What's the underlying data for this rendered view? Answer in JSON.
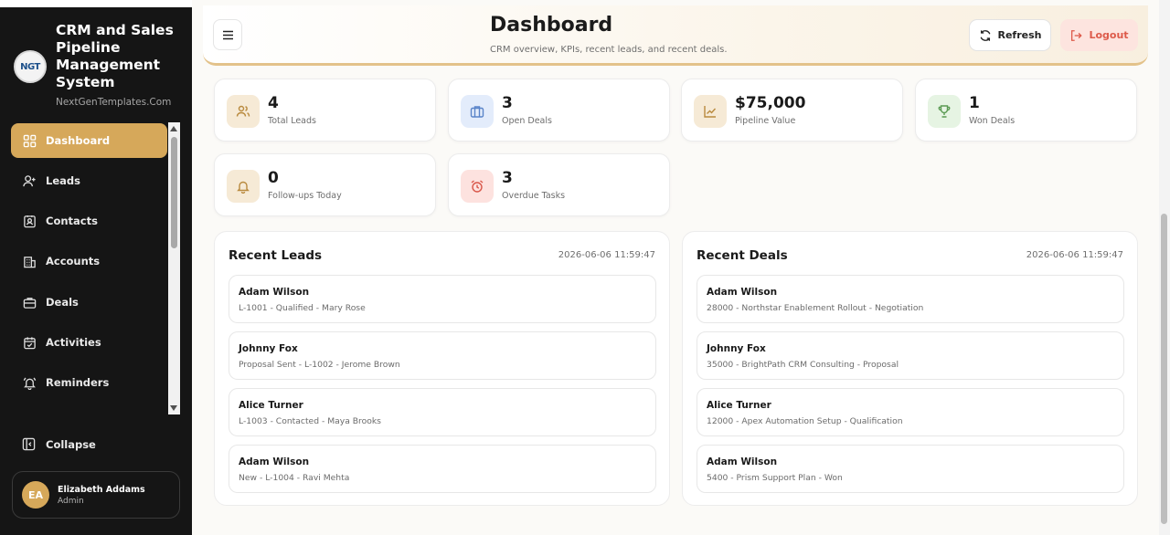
{
  "sidebar": {
    "brand_logo_text": "NGT",
    "brand_title": "CRM and Sales Pipeline Management System",
    "brand_subtitle": "NextGenTemplates.Com",
    "items": [
      {
        "label": "Dashboard",
        "icon": "grid-icon",
        "active": true
      },
      {
        "label": "Leads",
        "icon": "user-plus-icon",
        "active": false
      },
      {
        "label": "Contacts",
        "icon": "contact-card-icon",
        "active": false
      },
      {
        "label": "Accounts",
        "icon": "building-icon",
        "active": false
      },
      {
        "label": "Deals",
        "icon": "briefcase-icon",
        "active": false
      },
      {
        "label": "Activities",
        "icon": "calendar-check-icon",
        "active": false
      },
      {
        "label": "Reminders",
        "icon": "bell-ring-icon",
        "active": false
      }
    ],
    "collapse_label": "Collapse",
    "user": {
      "initials": "EA",
      "name": "Elizabeth Addams",
      "role": "Admin"
    }
  },
  "header": {
    "title": "Dashboard",
    "subtitle": "CRM overview, KPIs, recent leads, and recent deals.",
    "refresh_label": "Refresh",
    "logout_label": "Logout"
  },
  "kpis": [
    {
      "value": "4",
      "label": "Total Leads",
      "icon": "users-icon"
    },
    {
      "value": "3",
      "label": "Open Deals",
      "icon": "briefcase-icon"
    },
    {
      "value": "$75,000",
      "label": "Pipeline Value",
      "icon": "chart-line-icon"
    },
    {
      "value": "1",
      "label": "Won Deals",
      "icon": "trophy-icon"
    },
    {
      "value": "0",
      "label": "Follow-ups Today",
      "icon": "bell-icon"
    },
    {
      "value": "3",
      "label": "Overdue Tasks",
      "icon": "alarm-clock-icon"
    }
  ],
  "recent_leads": {
    "title": "Recent Leads",
    "timestamp": "2026-06-06 11:59:47",
    "items": [
      {
        "name": "Adam Wilson",
        "meta": "L-1001 - Qualified - Mary Rose"
      },
      {
        "name": "Johnny Fox",
        "meta": "Proposal Sent - L-1002 - Jerome Brown"
      },
      {
        "name": "Alice Turner",
        "meta": "L-1003 - Contacted - Maya Brooks"
      },
      {
        "name": "Adam Wilson",
        "meta": "New - L-1004 - Ravi Mehta"
      }
    ]
  },
  "recent_deals": {
    "title": "Recent Deals",
    "timestamp": "2026-06-06 11:59:47",
    "items": [
      {
        "name": "Adam Wilson",
        "meta": "28000 - Northstar Enablement Rollout - Negotiation"
      },
      {
        "name": "Johnny Fox",
        "meta": "35000 - BrightPath CRM Consulting - Proposal"
      },
      {
        "name": "Alice Turner",
        "meta": "12000 - Apex Automation Setup - Qualification"
      },
      {
        "name": "Adam Wilson",
        "meta": "5400 - Prism Support Plan - Won"
      }
    ]
  },
  "colors": {
    "accent": "#d6a85a",
    "sidebar_bg": "#151515",
    "logout_text": "#dd5a4a",
    "logout_bg": "#fde4df"
  }
}
